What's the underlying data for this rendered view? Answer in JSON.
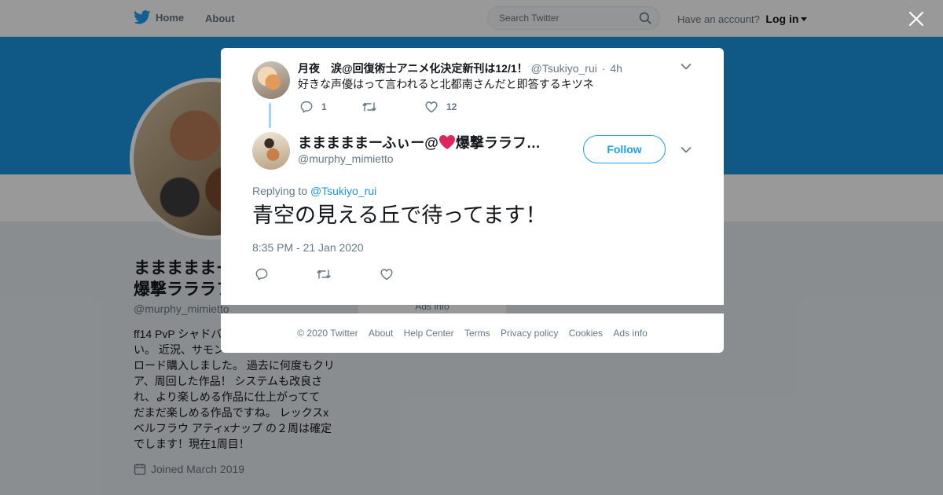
{
  "nav": {
    "home_label": "Home",
    "about_label": "About",
    "search_placeholder": "Search Twitter",
    "account_prompt": "Have an account?",
    "login_label": "Log in"
  },
  "profile": {
    "name_line1": "まままままー",
    "name_line2": "爆撃ラララフ",
    "handle": "@murphy_mimietto",
    "bio_lines": [
      "ff14 PvP シャドバ",
      "い。 近況、サモン",
      "ロード購入しました。 過去に何度もクリ",
      "ア、周回した作品！ システムも改良さ",
      "れ、より楽しめる作品に仕上がってて",
      "だまだ楽しめる作品ですね。 レックスx",
      "ベルフラウ アティxナップ の２周は確定",
      "でします！現在1周目！"
    ],
    "joined": "Joined March 2019",
    "ads_info": "Ads info"
  },
  "parent_tweet": {
    "author_name": "月夜　涙@回復術士アニメ化決定新刊は12/1！",
    "handle": "@Tsukiyo_rui",
    "separator": "·",
    "time": "4h",
    "text": "好きな声優はって言われると北都南さんだと即答するキツネ",
    "reply_count": "1",
    "retweet_count": "",
    "like_count": "12"
  },
  "main_tweet": {
    "author_name_part1": "まままままーふぃー@",
    "author_name_part2": "爆撃ララフ…",
    "handle": "@murphy_mimietto",
    "follow_label": "Follow",
    "replying_prefix": "Replying to",
    "replying_handle": "@Tsukiyo_rui",
    "text": "青空の見える丘で待ってます！",
    "timestamp": "8:35 PM - 21 Jan 2020"
  },
  "footer": {
    "links": [
      "© 2020 Twitter",
      "About",
      "Help Center",
      "Terms",
      "Privacy policy",
      "Cookies",
      "Ads info"
    ]
  },
  "colors": {
    "brand_blue": "#1da1f2",
    "banner": "#1b95e0",
    "heart_red": "#e0245e",
    "thread_line": "#a3d2f2"
  },
  "icons": [
    "twitter-bird-icon",
    "search-icon",
    "close-icon",
    "chevron-down-icon",
    "reply-icon",
    "retweet-icon",
    "like-icon",
    "calendar-icon",
    "heart-emoji"
  ]
}
